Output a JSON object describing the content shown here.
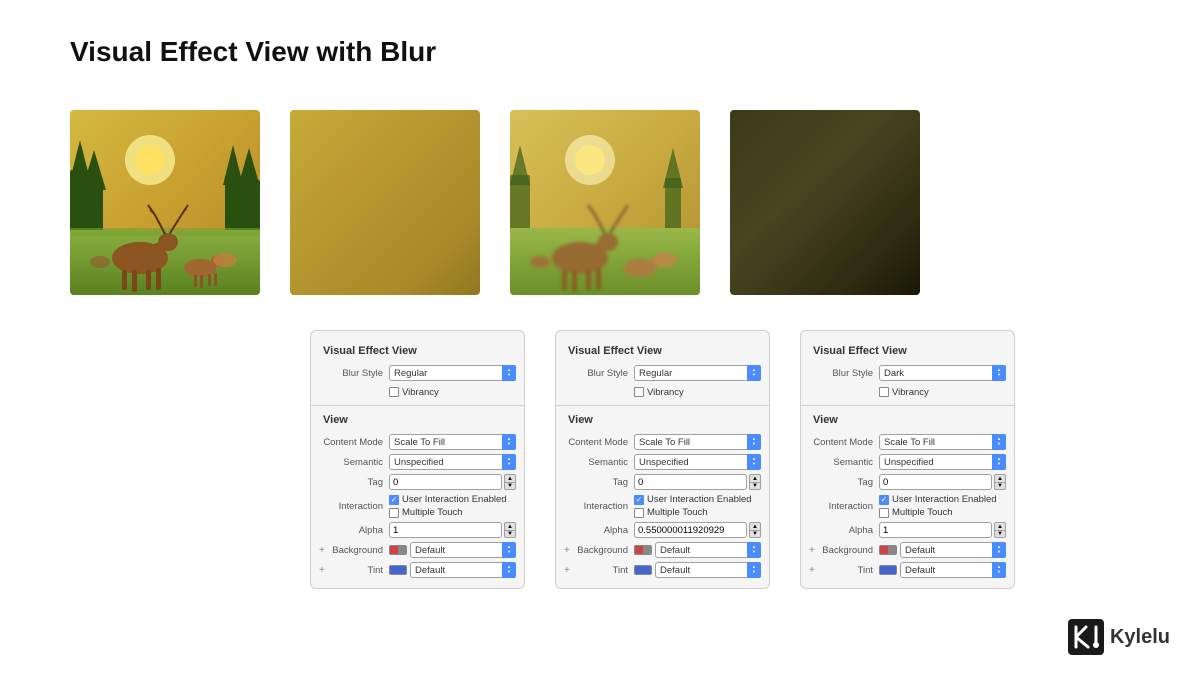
{
  "page": {
    "title": "Visual Effect View with Blur"
  },
  "images": [
    {
      "id": "original",
      "type": "deer-original",
      "alt": "Original deer scene"
    },
    {
      "id": "blur-light",
      "type": "blur-gold",
      "alt": "Light blur effect"
    },
    {
      "id": "blur-deer",
      "type": "deer-blur",
      "alt": "Deer scene with blur"
    },
    {
      "id": "blur-dark",
      "type": "dark-blur",
      "alt": "Dark blur effect"
    }
  ],
  "panels": [
    {
      "id": "panel-1",
      "visual_effect_section": "Visual Effect View",
      "blur_style_label": "Blur Style",
      "blur_style_value": "Regular",
      "vibrancy_label": "Vibrancy",
      "vibrancy_checked": false,
      "view_section": "View",
      "content_mode_label": "Content Mode",
      "content_mode_value": "Scale To Fill",
      "semantic_label": "Semantic",
      "semantic_value": "Unspecified",
      "tag_label": "Tag",
      "tag_value": "0",
      "interaction_label": "Interaction",
      "user_interaction_label": "User Interaction Enabled",
      "user_interaction_checked": true,
      "multiple_touch_label": "Multiple Touch",
      "multiple_touch_checked": false,
      "alpha_label": "Alpha",
      "alpha_value": "1",
      "background_label": "Background",
      "background_value": "Default",
      "tint_label": "Tint",
      "tint_value": "Default"
    },
    {
      "id": "panel-2",
      "visual_effect_section": "Visual Effect View",
      "blur_style_label": "Blur Style",
      "blur_style_value": "Regular",
      "vibrancy_label": "Vibrancy",
      "vibrancy_checked": false,
      "view_section": "View",
      "content_mode_label": "Content Mode",
      "content_mode_value": "Scale To Fill",
      "semantic_label": "Semantic",
      "semantic_value": "Unspecified",
      "tag_label": "Tag",
      "tag_value": "0",
      "interaction_label": "Interaction",
      "user_interaction_label": "User Interaction Enabled",
      "user_interaction_checked": true,
      "multiple_touch_label": "Multiple Touch",
      "multiple_touch_checked": false,
      "alpha_label": "Alpha",
      "alpha_value": "0.550000011920929",
      "background_label": "Background",
      "background_value": "Default",
      "tint_label": "Tint",
      "tint_value": "Default"
    },
    {
      "id": "panel-3",
      "visual_effect_section": "Visual Effect View",
      "blur_style_label": "Blur Style",
      "blur_style_value": "Dark",
      "vibrancy_label": "Vibrancy",
      "vibrancy_checked": false,
      "view_section": "View",
      "content_mode_label": "Content Mode",
      "content_mode_value": "Scale To Fill",
      "semantic_label": "Semantic",
      "semantic_value": "Unspecified",
      "tag_label": "Tag",
      "tag_value": "0",
      "interaction_label": "Interaction",
      "user_interaction_label": "User Interaction Enabled",
      "user_interaction_checked": true,
      "multiple_touch_label": "Multiple Touch",
      "multiple_touch_checked": false,
      "alpha_label": "Alpha",
      "alpha_value": "1",
      "background_label": "Background",
      "background_value": "Default",
      "tint_label": "Tint",
      "tint_value": "Default"
    }
  ],
  "branding": {
    "name": "Kylelu"
  }
}
